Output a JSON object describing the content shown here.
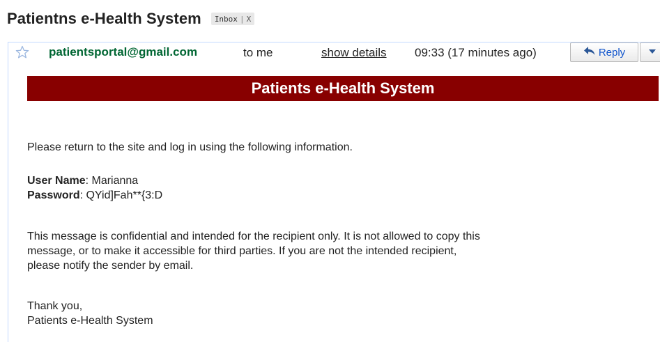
{
  "subject": "Patientns e-Health System",
  "label": {
    "name": "Inbox",
    "separator": "|",
    "remove": "X"
  },
  "header": {
    "sender": "patientsportal@gmail.com",
    "to": "to me",
    "show_details": "show details",
    "time": "09:33 (17 minutes ago)",
    "reply_label": "Reply",
    "icons": {
      "star": "star-outline-icon",
      "reply": "reply-arrow-icon",
      "more": "dropdown-arrow-icon"
    }
  },
  "email": {
    "banner_title": "Patients e-Health System",
    "intro": "Please return to the site and log in using the following information.",
    "username_label": "User Name",
    "username_value": ": Marianna",
    "password_label": "Password",
    "password_value": ": QYid]Fah**{3:D",
    "notice_line1": "This message is confidential and intended for the recipient only. It is not allowed to copy this",
    "notice_line2": "message, or to make it accessible for third parties. If you are not the intended recipient,",
    "notice_line3": "please notify the sender by email.",
    "thanks_line1": "Thank you,",
    "thanks_line2": "Patients e-Health System"
  },
  "colors": {
    "banner_bg": "#880000",
    "sender": "#006633",
    "link_blue": "#15c"
  }
}
